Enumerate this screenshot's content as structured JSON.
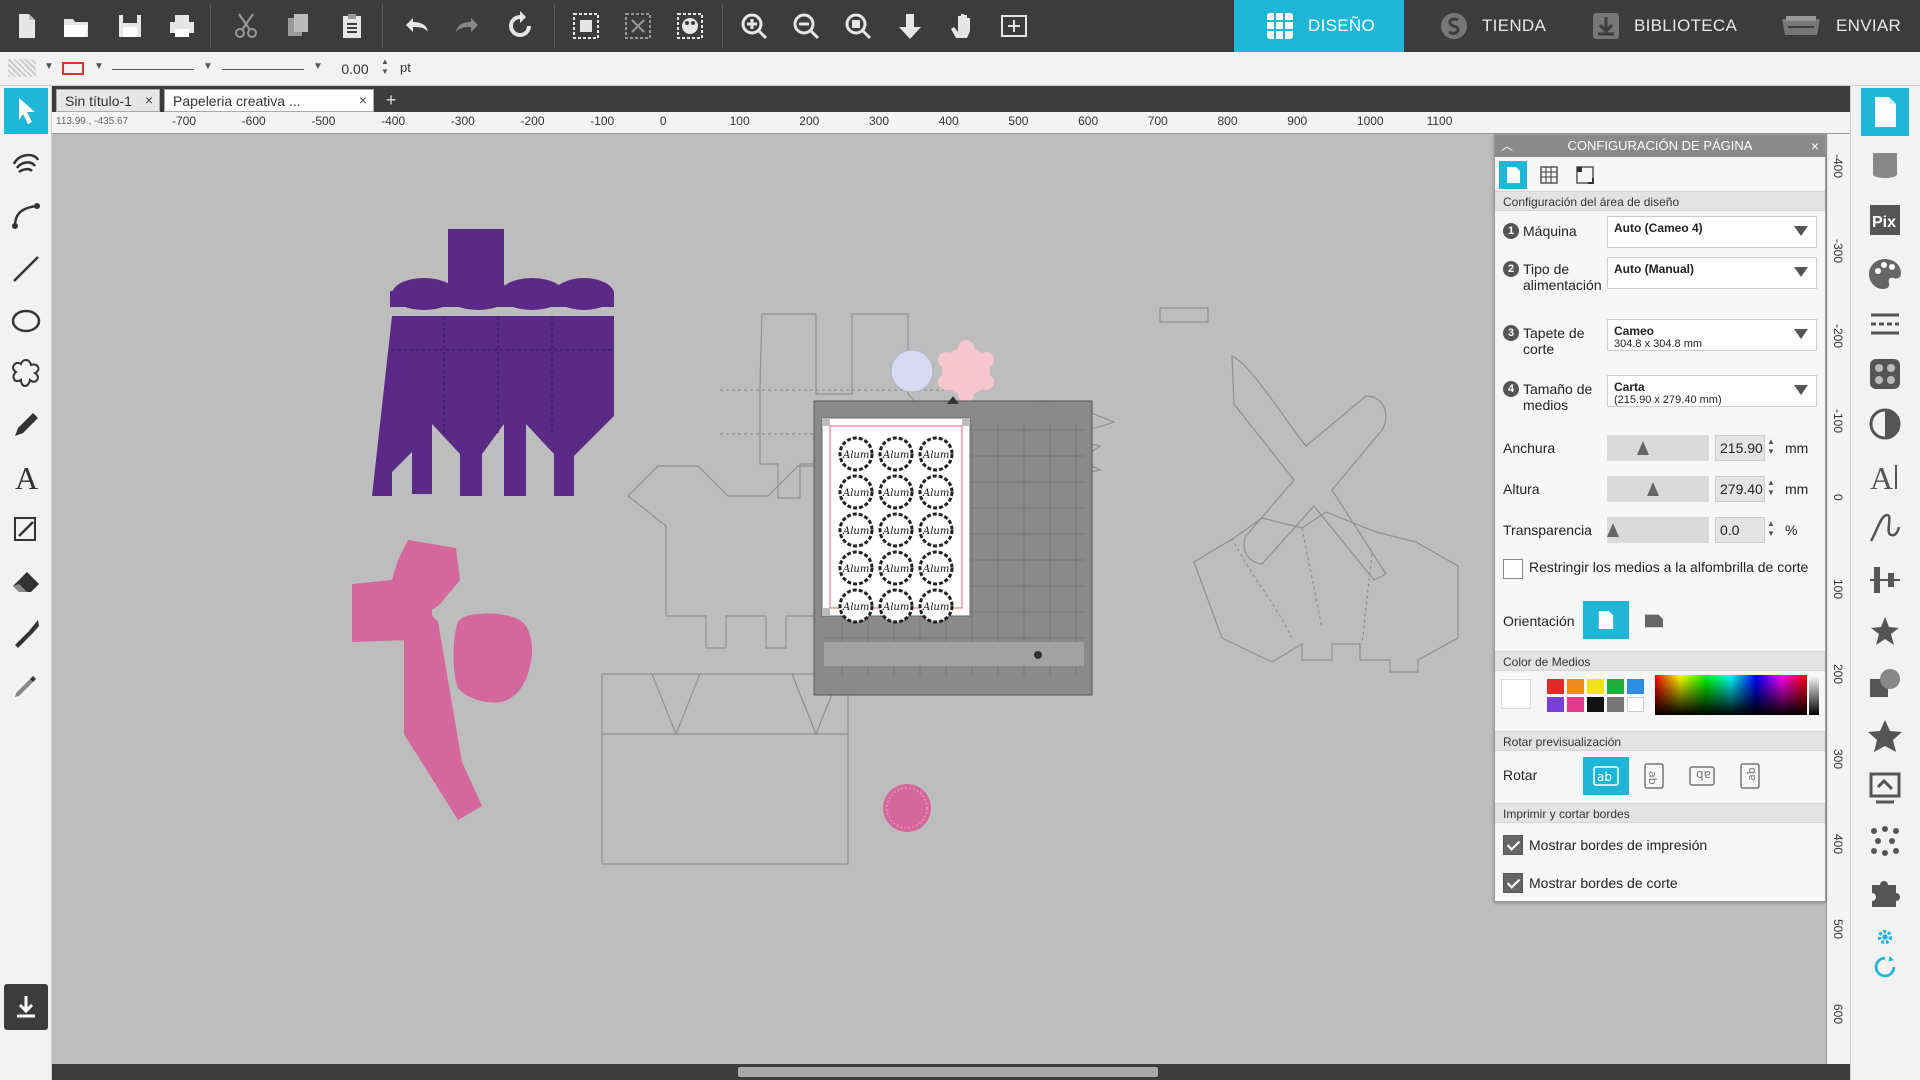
{
  "topbar": {
    "nav_tabs": [
      {
        "label": "DISEÑO",
        "icon": "grid-icon",
        "active": true
      },
      {
        "label": "TIENDA",
        "icon": "silhouette-s-icon",
        "active": false
      },
      {
        "label": "BIBLIOTECA",
        "icon": "library-download-icon",
        "active": false
      },
      {
        "label": "ENVIAR",
        "icon": "cutter-machine-icon",
        "active": false
      }
    ],
    "accent": "#1fb6d8"
  },
  "toolbar2": {
    "stroke_value": "0.00",
    "stroke_unit": "pt"
  },
  "doc_tabs": [
    {
      "label": "Sin título-1"
    },
    {
      "label": "Papeleria creativa ..."
    }
  ],
  "coord_readout": "113.99 , -435.67",
  "ruler": {
    "h_ticks": [
      "-700",
      "-600",
      "-500",
      "-400",
      "-300",
      "-200",
      "-100",
      "0",
      "100",
      "200",
      "300",
      "400",
      "500",
      "600",
      "700",
      "800",
      "900",
      "1000",
      "1100"
    ],
    "v_ticks": [
      "-400",
      "-300",
      "-200",
      "-100",
      "0",
      "100",
      "200",
      "300",
      "400",
      "500",
      "600"
    ]
  },
  "panel": {
    "title": "CONFIGURACIÓN DE PÁGINA",
    "section_design_area": "Configuración del área de diseño",
    "machine": {
      "step": "1",
      "label": "Máquina",
      "value": "Auto (Cameo 4)"
    },
    "feed": {
      "step": "2",
      "label": "Tipo de alimentación",
      "value": "Auto (Manual)"
    },
    "mat": {
      "step": "3",
      "label": "Tapete de corte",
      "value": "Cameo",
      "sub": "304.8 x 304.8 mm"
    },
    "media_size": {
      "step": "4",
      "label": "Tamaño de medios",
      "value": "Carta",
      "sub": "(215.90 x 279.40 mm)"
    },
    "width": {
      "label": "Anchura",
      "value": "215.90",
      "unit": "mm"
    },
    "height": {
      "label": "Altura",
      "value": "279.40",
      "unit": "mm"
    },
    "transparency": {
      "label": "Transparencia",
      "value": "0.0",
      "unit": "%"
    },
    "restrict_label": "Restringir los medios a la alfombrilla de corte",
    "orientation_label": "Orientación",
    "section_media_color": "Color de Medios",
    "swatches": [
      "#e02a2a",
      "#f08a1d",
      "#f2e21a",
      "#1fae3c",
      "#2f8de4",
      "#7a3fd8",
      "#e23a8c",
      "#111111",
      "#777777",
      "#ffffff"
    ],
    "section_rotate": "Rotar previsualización",
    "rotate_label": "Rotar",
    "section_print_cut": "Imprimir y cortar bordes",
    "show_print_borders": "Mostrar bordes de impresión",
    "show_cut_borders": "Mostrar bordes de corte"
  },
  "canvas": {
    "colors": {
      "purple": "#5b2a86",
      "pink": "#d4679c",
      "light_pink": "#f7c6d1",
      "lavender": "#d9d9f2",
      "mat": "#8a8a8a"
    },
    "label_text": "Alum"
  }
}
